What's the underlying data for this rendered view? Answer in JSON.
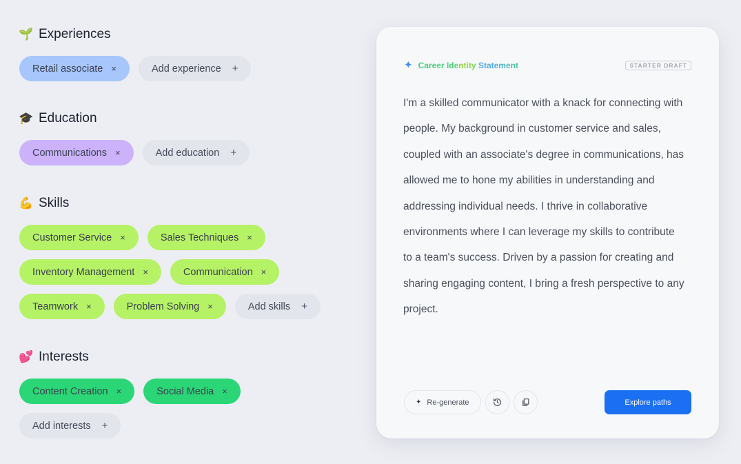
{
  "sections": {
    "experiences": {
      "title": "Experiences",
      "icon": "seedling-icon",
      "emoji": "🌱",
      "chips": [
        {
          "label": "Retail associate"
        }
      ],
      "add_label": "Add experience",
      "chip_color": "#a7c6fb"
    },
    "education": {
      "title": "Education",
      "icon": "graduation-cap-icon",
      "emoji": "🎓",
      "chips": [
        {
          "label": "Communications"
        }
      ],
      "add_label": "Add education",
      "chip_color": "#cbb2fa"
    },
    "skills": {
      "title": "Skills",
      "icon": "flexed-biceps-icon",
      "emoji": "💪",
      "chips": [
        {
          "label": "Customer Service"
        },
        {
          "label": "Sales Techniques"
        },
        {
          "label": "Inventory Management"
        },
        {
          "label": "Communication"
        },
        {
          "label": "Teamwork"
        },
        {
          "label": "Problem Solving"
        }
      ],
      "add_label": "Add skills",
      "chip_color": "#b6f265"
    },
    "interests": {
      "title": "Interests",
      "icon": "two-hearts-icon",
      "emoji": "💕",
      "chips": [
        {
          "label": "Content Creation"
        },
        {
          "label": "Social Media"
        }
      ],
      "add_label": "Add interests",
      "chip_color": "#2bd676"
    }
  },
  "icons": {
    "remove": "×",
    "add": "+",
    "sparkle": "✦"
  },
  "card": {
    "title": "Career Identity Statement",
    "badge": "STARTER DRAFT",
    "statement": "I'm a skilled communicator with a knack for connecting with people. My background in customer service and sales, coupled with an associate's degree in communications, has allowed me to hone my abilities in understanding and addressing individual needs. I thrive in collaborative environments where I can leverage my skills to contribute to a team's success. Driven by a passion for creating and sharing engaging content, I bring a fresh perspective to any project.",
    "regenerate_label": "Re-generate",
    "history_icon": "history-icon",
    "copy_icon": "copy-icon",
    "primary_label": "Explore paths",
    "primary_color": "#1a6ff2"
  }
}
